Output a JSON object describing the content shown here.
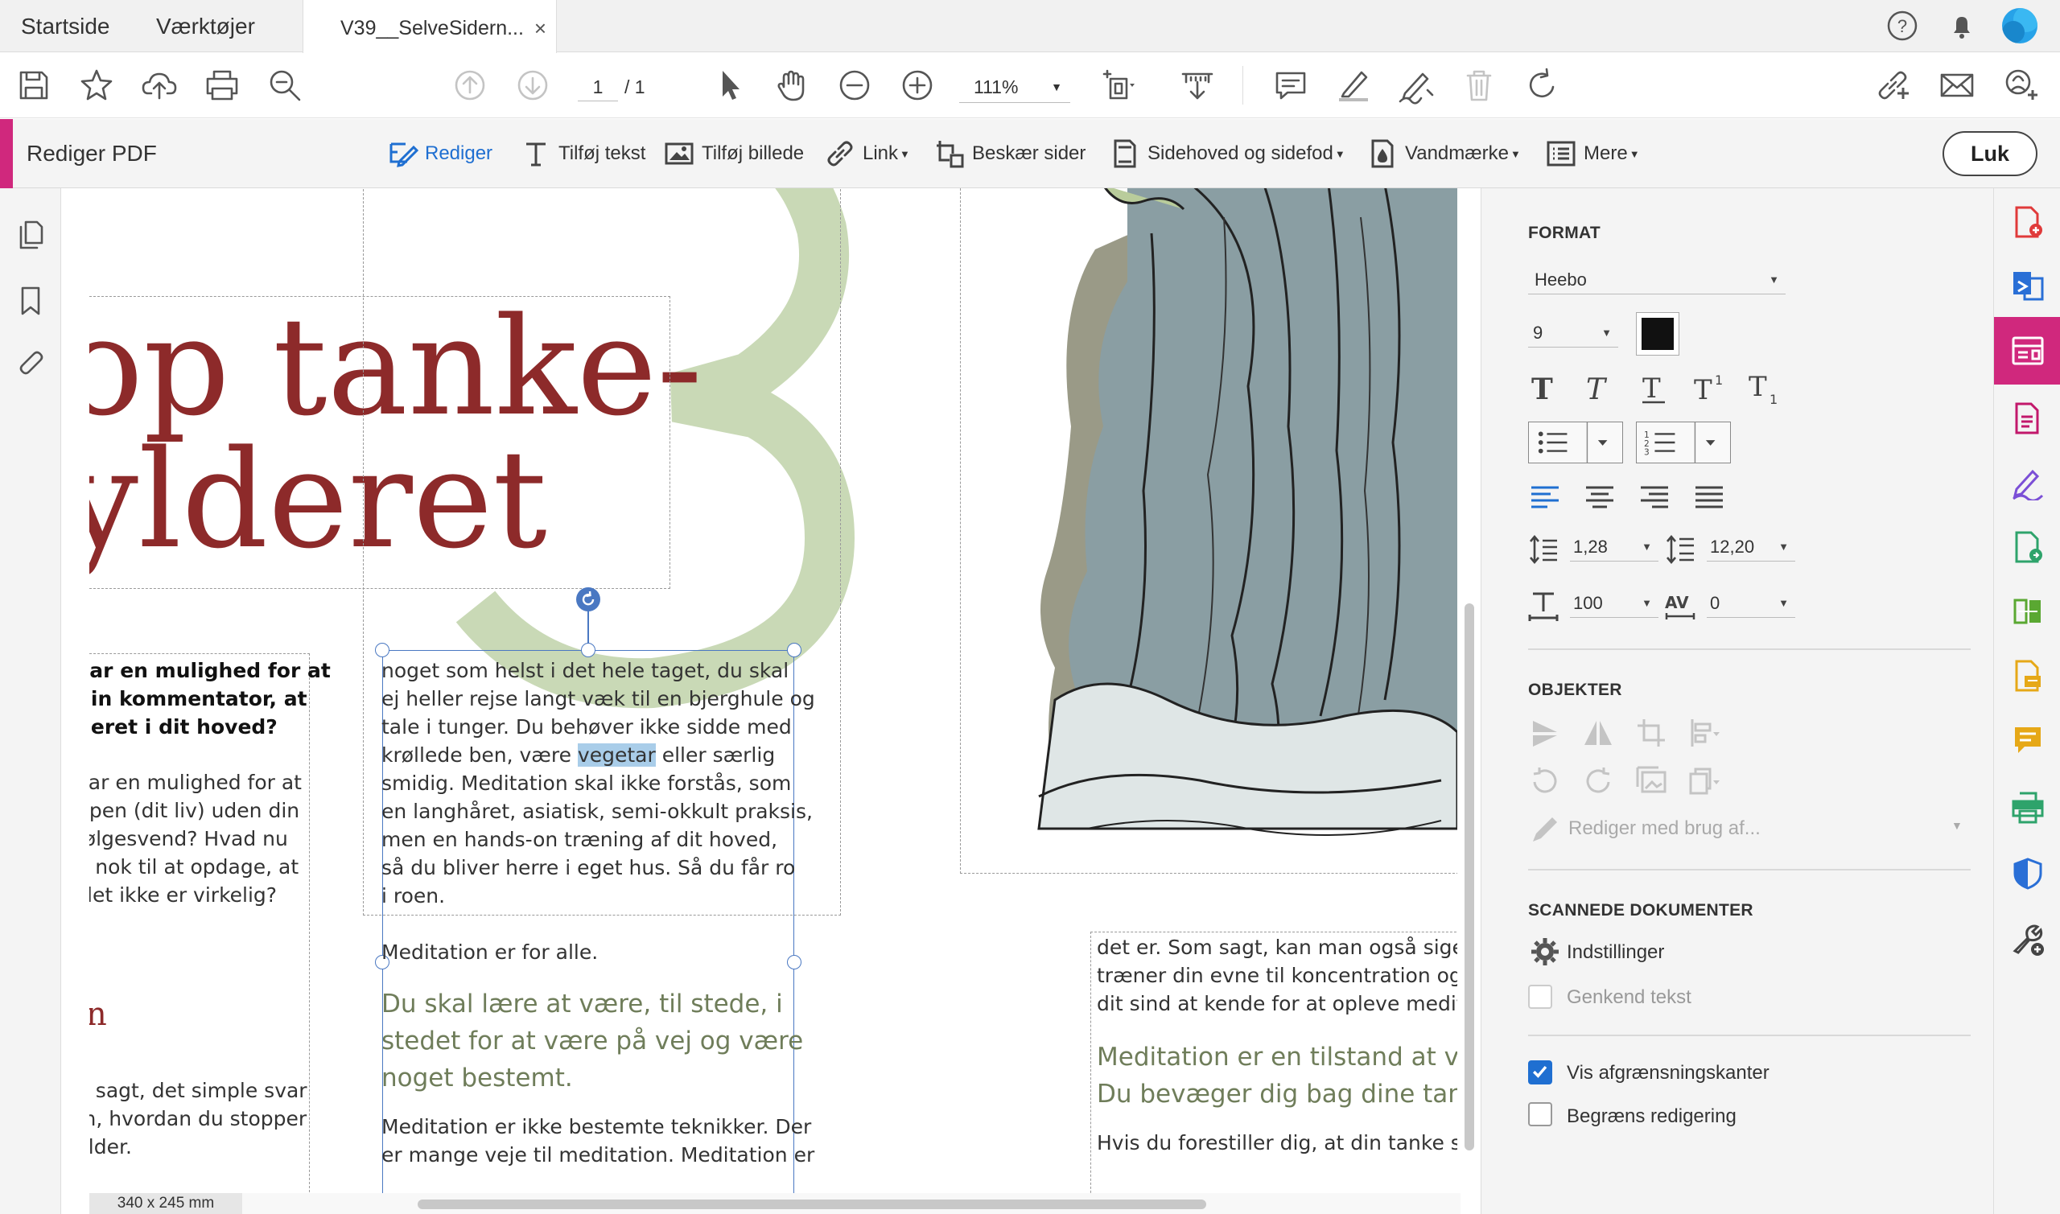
{
  "tabs": {
    "home": "Startside",
    "tools": "Værktøjer",
    "document": "V39__SelveSidern...",
    "close": "×"
  },
  "toolbar": {
    "page_current": "1",
    "page_total": "/ 1",
    "zoom": "111%"
  },
  "edit_bar": {
    "title": "Rediger PDF",
    "edit": "Rediger",
    "add_text": "Tilføj tekst",
    "add_image": "Tilføj billede",
    "link": "Link",
    "crop": "Beskær sider",
    "header_footer": "Sidehoved og sidefod",
    "watermark": "Vandmærke",
    "more": "Mere",
    "close": "Luk"
  },
  "document": {
    "headline_line1": "op tanke-",
    "headline_line2": "ylderet",
    "big_numeral": "3",
    "left_col": {
      "bold_lines": [
        "var en mulighed for at",
        " din kommentator, at",
        "deret i dit hoved?"
      ],
      "body_lines": [
        "var en mulighed for at",
        "npen (dit liv) uden din",
        "følgesvend? Hvad nu",
        "o nok til at opdage, at",
        " slet ikke er virkelig?"
      ],
      "heading_fragment": "n",
      "body2_lines": [
        "n sagt, det simple svar",
        "m, hvordan du stopper",
        "ylder."
      ]
    },
    "mid_col": {
      "para_lines_pre": [
        "noget som helst i det hele taget, du skal",
        "ej heller rejse langt væk til en bjerghule og",
        "tale i tunger. Du behøver ikke sidde med"
      ],
      "hl_before": "krøllede ben, være ",
      "hl_word": "vegetar",
      "hl_after": " eller særlig",
      "para_lines_post": [
        "smidig. Meditation skal ikke forstås, som",
        "en langhåret, asiatisk, semi-okkult praksis,",
        "men en hands-on træning af dit hoved,",
        "så du bliver herre i eget hus. Så du får ro",
        "i roen."
      ],
      "line_alone": "Meditation er for alle.",
      "quote_lines": [
        "Du skal lære at være, til stede, i",
        "stedet for at være på vej og være",
        "noget bestemt."
      ],
      "para2_lines": [
        "Meditation er ikke bestemte teknikker. Der",
        "er mange veje til meditation. Meditation er"
      ]
    },
    "right_col": {
      "body_lines": [
        "det er. Som sagt, kan man også sige, a",
        "træner din evne til koncentration og læ",
        "dit sind at kende for at opleve meditat"
      ],
      "quote_lines": [
        "Meditation er en tilstand at vær",
        "Du bevæger dig bag dine tanke"
      ],
      "body2": "Hvis du forestiller dig, at din tanke strø"
    },
    "page_size": "340 x 245 mm"
  },
  "format_panel": {
    "section_format": "FORMAT",
    "font": "Heebo",
    "font_size": "9",
    "text_color": "#111111",
    "line_spacing": "1,28",
    "para_spacing": "12,20",
    "h_scale": "100",
    "char_spacing": "0",
    "section_objects": "OBJEKTER",
    "edit_with": "Rediger med brug af...",
    "section_scanned": "SCANNEDE DOKUMENTER",
    "settings": "Indstillinger",
    "recognize_text": "Genkend tekst",
    "show_bounds": "Vis afgrænsningskanter",
    "restrict_editing": "Begræns redigering"
  },
  "colors": {
    "accent_pink": "#d0287d",
    "accent_blue": "#1f6fd1",
    "headline_red": "#8d2a2a",
    "numeral_green": "#c9d9b6",
    "quote_green": "#6f7d5a"
  },
  "icons": [
    "save-icon",
    "bookmark-star-icon",
    "upload-icon",
    "print-icon",
    "search-zoom-icon",
    "page-up-icon",
    "page-down-icon",
    "select-arrow-icon",
    "hand-icon",
    "zoom-out-icon",
    "zoom-in-icon",
    "fit-page-icon",
    "scroll-mode-icon",
    "comment-icon",
    "highlight-icon",
    "sign-icon",
    "delete-icon",
    "rotate-icon",
    "share-link-icon",
    "mail-icon",
    "add-user-icon"
  ]
}
